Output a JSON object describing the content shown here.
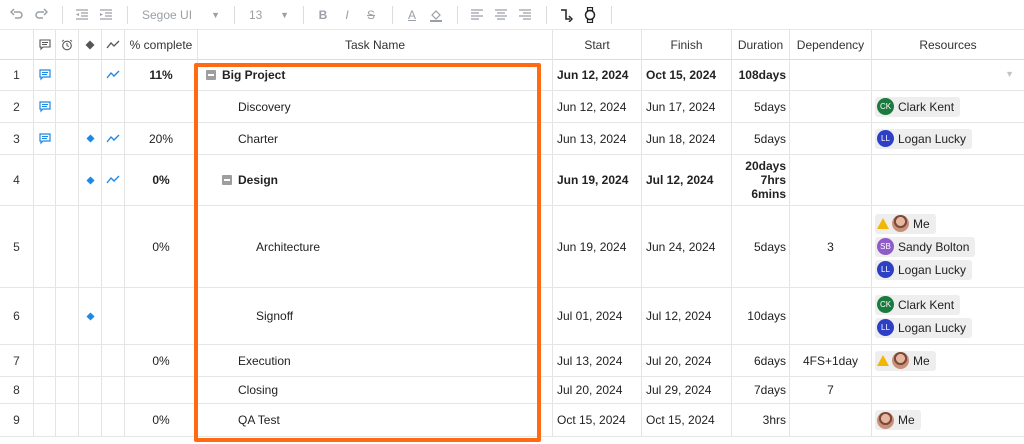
{
  "toolbar": {
    "font": "Segoe UI",
    "font_size": "13",
    "buttons": [
      "undo-icon",
      "redo-icon",
      "outdent-icon",
      "indent-icon",
      "bold-icon",
      "italic-icon",
      "strikethrough-icon",
      "text-color-icon",
      "fill-color-icon",
      "align-left-icon",
      "align-center-icon",
      "align-right-icon",
      "dependency-arrow-icon",
      "watch-icon"
    ],
    "bold_label": "B",
    "italic_label": "I",
    "strike_label": "S",
    "text_color_label": "A"
  },
  "columns": {
    "pct": "% complete",
    "task": "Task Name",
    "start": "Start",
    "finish": "Finish",
    "duration": "Duration",
    "dependency": "Dependency",
    "resources": "Resources"
  },
  "rows": [
    {
      "num": "1",
      "pct": "11%",
      "task": "Big Project",
      "start": "Jun 12, 2024",
      "finish": "Oct 15, 2024",
      "duration": "108days",
      "dependency": ""
    },
    {
      "num": "2",
      "pct": "",
      "task": "Discovery",
      "start": "Jun 12, 2024",
      "finish": "Jun 17, 2024",
      "duration": "5days",
      "dependency": ""
    },
    {
      "num": "3",
      "pct": "20%",
      "task": "Charter",
      "start": "Jun 13, 2024",
      "finish": "Jun 18, 2024",
      "duration": "5days",
      "dependency": ""
    },
    {
      "num": "4",
      "pct": "0%",
      "task": "Design",
      "start": "Jun 19, 2024",
      "finish": "Jul 12, 2024",
      "duration_lines": [
        "20days",
        "7hrs",
        "6mins"
      ],
      "dependency": ""
    },
    {
      "num": "5",
      "pct": "0%",
      "task": "Architecture",
      "start": "Jun 19, 2024",
      "finish": "Jun 24, 2024",
      "duration": "5days",
      "dependency": "3"
    },
    {
      "num": "6",
      "pct": "",
      "task": "Signoff",
      "start": "Jul 01, 2024",
      "finish": "Jul 12, 2024",
      "duration": "10days",
      "dependency": ""
    },
    {
      "num": "7",
      "pct": "0%",
      "task": "Execution",
      "start": "Jul 13, 2024",
      "finish": "Jul 20, 2024",
      "duration": "6days",
      "dependency": "4FS+1day"
    },
    {
      "num": "8",
      "pct": "",
      "task": "Closing",
      "start": "Jul 20, 2024",
      "finish": "Jul 29, 2024",
      "duration": "7days",
      "dependency": "7"
    },
    {
      "num": "9",
      "pct": "0%",
      "task": "QA Test",
      "start": "Oct 15, 2024",
      "finish": "Oct 15, 2024",
      "duration": "3hrs",
      "dependency": ""
    }
  ],
  "people": {
    "clark": {
      "initials": "CK",
      "name": "Clark Kent"
    },
    "logan": {
      "initials": "LL",
      "name": "Logan Lucky"
    },
    "sandy": {
      "initials": "SB",
      "name": "Sandy Bolton"
    },
    "me": {
      "name": "Me"
    }
  },
  "colors": {
    "highlight": "#ff6a13",
    "icon_blue": "#1e88e5",
    "clark_avatar": "#1b7a3d",
    "logan_avatar": "#2d3fc4",
    "sandy_avatar": "#8e5bc9",
    "warning": "#f2b705"
  }
}
